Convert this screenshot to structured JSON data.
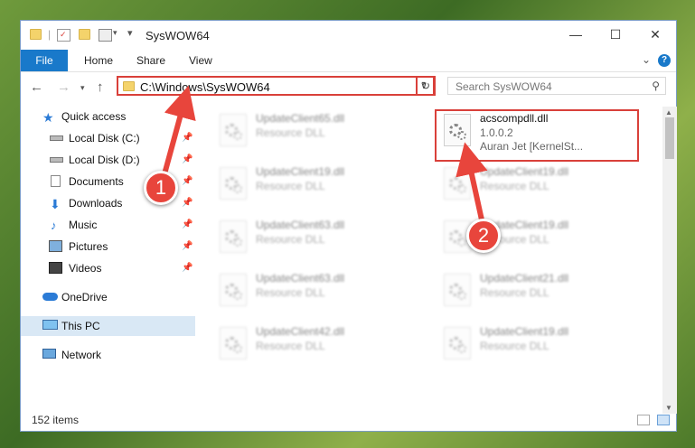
{
  "window": {
    "title": "SysWOW64",
    "controls": {
      "minimize": "—",
      "maximize": "☐",
      "close": "✕"
    }
  },
  "ribbon": {
    "tabs": [
      "File",
      "Home",
      "Share",
      "View"
    ],
    "help_icon": "?"
  },
  "navigation": {
    "address": "C:\\Windows\\SysWOW64",
    "search_placeholder": "Search SysWOW64"
  },
  "sidebar": {
    "items": [
      {
        "label": "Quick access",
        "icon": "star-icon"
      },
      {
        "label": "Local Disk (C:)",
        "icon": "drive-icon"
      },
      {
        "label": "Local Disk (D:)",
        "icon": "drive-icon"
      },
      {
        "label": "Documents",
        "icon": "documents-icon"
      },
      {
        "label": "Downloads",
        "icon": "downloads-icon"
      },
      {
        "label": "Music",
        "icon": "music-icon"
      },
      {
        "label": "Pictures",
        "icon": "pictures-icon"
      },
      {
        "label": "Videos",
        "icon": "videos-icon"
      },
      {
        "label": "OneDrive",
        "icon": "cloud-icon"
      },
      {
        "label": "This PC",
        "icon": "computer-icon"
      },
      {
        "label": "Network",
        "icon": "network-icon"
      }
    ]
  },
  "files": {
    "highlighted": {
      "name": "acscompdll.dll",
      "version": "1.0.0.2",
      "company": "Auran Jet [KernelSt..."
    },
    "left_column": [
      {
        "name": "UpdateClient65.dll",
        "desc": "Resource DLL"
      },
      {
        "name": "UpdateClient19.dll",
        "desc": "Resource DLL"
      },
      {
        "name": "UpdateClient63.dll",
        "desc": "Resource DLL"
      },
      {
        "name": "UpdateClient63.dll",
        "desc": "Resource DLL"
      },
      {
        "name": "UpdateClient42.dll",
        "desc": "Resource DLL"
      }
    ],
    "right_column": [
      {
        "name": "UpdateClient19.dll",
        "desc": "Resource DLL"
      },
      {
        "name": "UpdateClient19.dll",
        "desc": "Resource DLL"
      },
      {
        "name": "UpdateClient21.dll",
        "desc": "Resource DLL"
      },
      {
        "name": "UpdateClient19.dll",
        "desc": "Resource DLL"
      }
    ]
  },
  "status": {
    "item_count": "152 items"
  },
  "annotations": {
    "badge_1": "1",
    "badge_2": "2",
    "accent": "#e8453c"
  }
}
